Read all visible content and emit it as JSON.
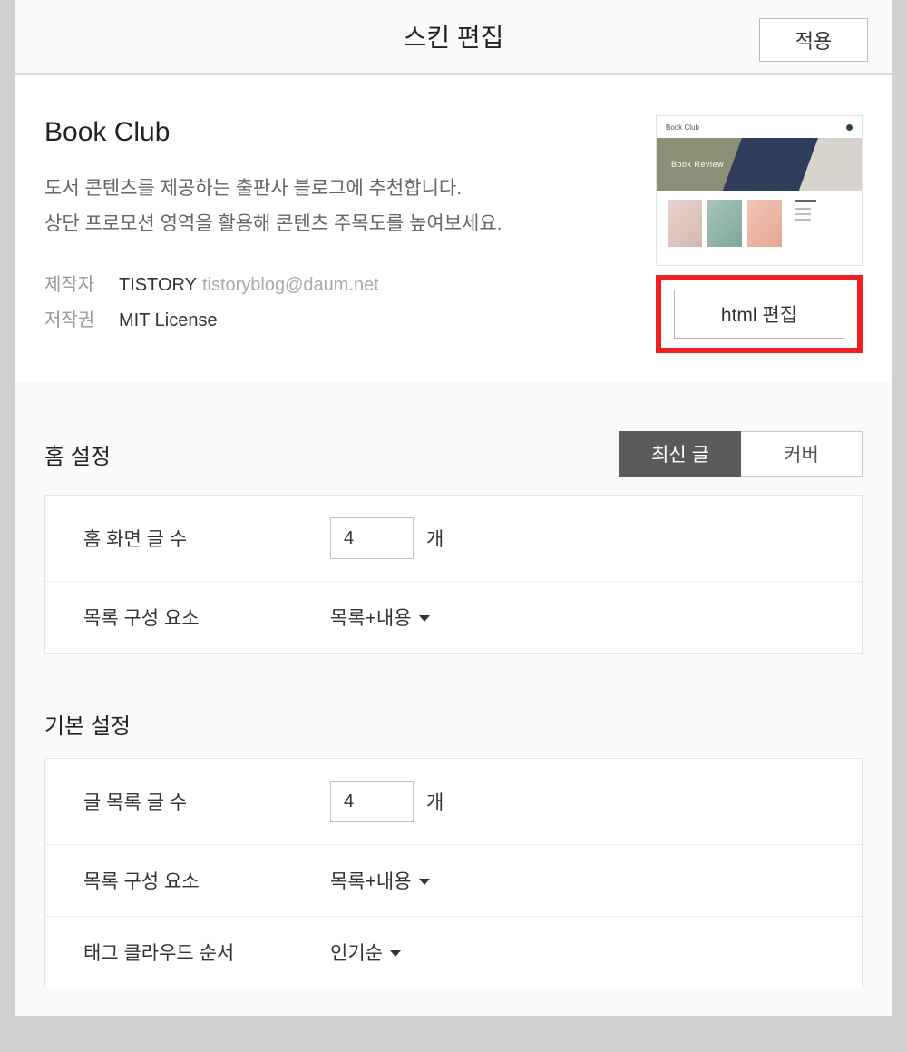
{
  "header": {
    "title": "스킨 편집",
    "apply_label": "적용"
  },
  "skin": {
    "name": "Book Club",
    "desc_line1": "도서 콘텐츠를 제공하는 출판사 블로그에 추천합니다.",
    "desc_line2": "상단 프로모션 영역을 활용해 콘텐츠 주목도를 높여보세요.",
    "maker_label": "제작자",
    "maker_name": "TISTORY",
    "maker_email": "tistoryblog@daum.net",
    "license_label": "저작권",
    "license_value": "MIT License",
    "preview_logo": "Book Club",
    "preview_hero_text": "Book Review",
    "html_edit_label": "html 편집"
  },
  "home_settings": {
    "title": "홈 설정",
    "tab_latest": "최신 글",
    "tab_cover": "커버",
    "rows": {
      "post_count_label": "홈 화면 글 수",
      "post_count_value": "4",
      "post_count_unit": "개",
      "list_component_label": "목록 구성 요소",
      "list_component_value": "목록+내용"
    }
  },
  "basic_settings": {
    "title": "기본 설정",
    "rows": {
      "list_count_label": "글 목록 글 수",
      "list_count_value": "4",
      "list_count_unit": "개",
      "list_component_label": "목록 구성 요소",
      "list_component_value": "목록+내용",
      "tag_order_label": "태그 클라우드 순서",
      "tag_order_value": "인기순"
    }
  }
}
